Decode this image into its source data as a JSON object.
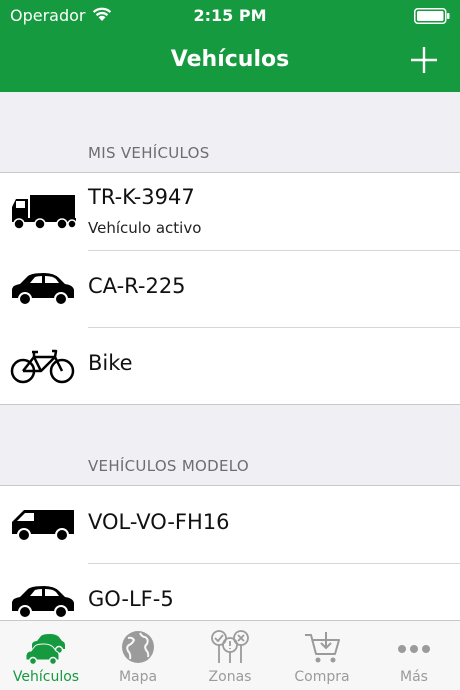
{
  "status": {
    "carrier": "Operador",
    "time": "2:15 PM"
  },
  "nav": {
    "title": "Vehículos"
  },
  "sections": {
    "mine": {
      "header": "MIS VEHÍCULOS",
      "items": [
        {
          "plate": "TR-K-3947",
          "sub": "Vehículo activo",
          "icon": "truck-icon"
        },
        {
          "plate": "CA-R-225",
          "icon": "car-icon"
        },
        {
          "plate": "Bike",
          "icon": "bicycle-icon"
        }
      ]
    },
    "models": {
      "header": "VEHÍCULOS MODELO",
      "items": [
        {
          "plate": "VOL-VO-FH16",
          "icon": "van-icon"
        },
        {
          "plate": "GO-LF-5",
          "icon": "car-icon"
        }
      ]
    }
  },
  "tabs": [
    {
      "label": "Vehículos",
      "icon": "vehicles-icon",
      "active": true
    },
    {
      "label": "Mapa",
      "icon": "globe-icon"
    },
    {
      "label": "Zonas",
      "icon": "zones-icon"
    },
    {
      "label": "Compra",
      "icon": "cart-icon"
    },
    {
      "label": "Más",
      "icon": "more-icon"
    }
  ],
  "colors": {
    "accent": "#169a3f",
    "tab_inactive": "#9b9b9b",
    "background": "#efeff4"
  }
}
